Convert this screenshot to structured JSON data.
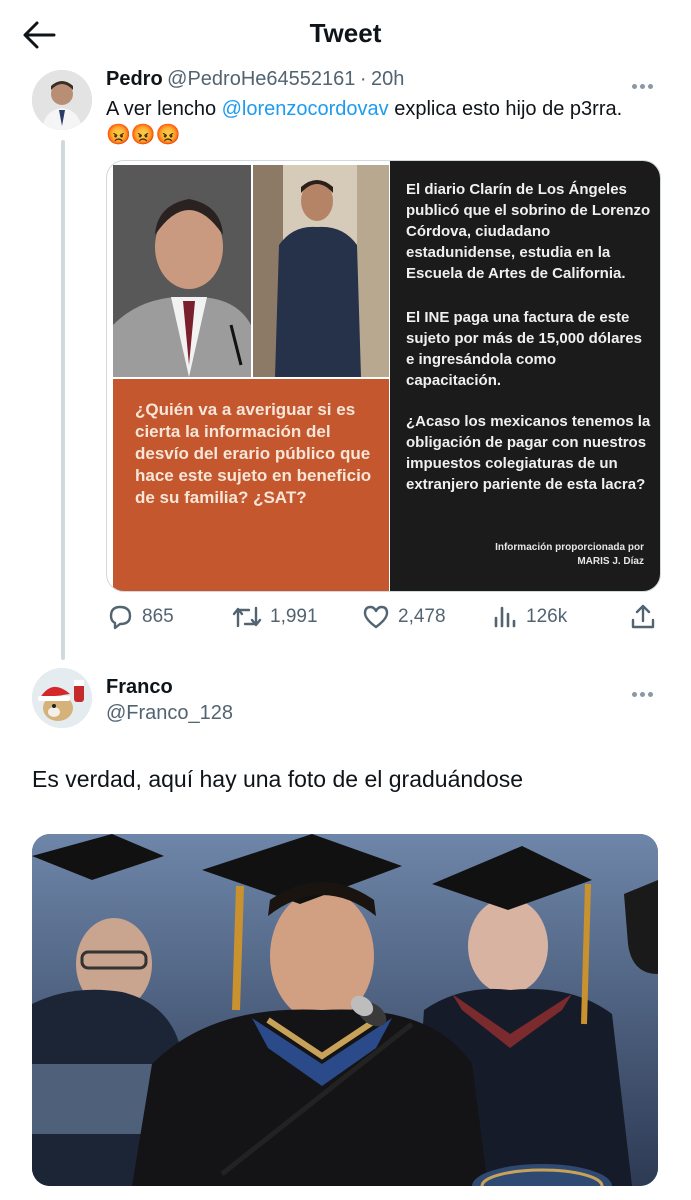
{
  "header": {
    "title": "Tweet"
  },
  "tweet": {
    "author_name": "Pedro",
    "handle": "@PedroHe64552161",
    "dot": "·",
    "time": "20h",
    "text_before": "A ver lencho ",
    "mention": "@lorenzocordovav",
    "text_after": " explica esto hijo de p3rra.",
    "emojis": "😡😡😡",
    "image": {
      "orange_text": "¿Quién va a averiguar si es cierta la información del desvío del erario público que hace este sujeto en beneficio de su familia? ¿SAT?",
      "para1": "El diario Clarín de Los Ángeles publicó que el sobrino de Lorenzo Córdova, ciudadano estadunidense, estudia en la Escuela de Artes de California.",
      "para2": "El INE paga una factura de este sujeto por más de 15,000 dólares e ingresándola como capacitación.",
      "para3": "¿Acaso los mexicanos tenemos la obligación de pagar con nuestros impuestos colegiaturas de un extranjero pariente de esta lacra?",
      "credit1": "Información proporcionada por",
      "credit2": "MARIS J. Díaz"
    },
    "stats": {
      "replies": "865",
      "retweets": "1,991",
      "likes": "2,478",
      "views": "126k"
    }
  },
  "reply": {
    "author_name": "Franco",
    "handle": "@Franco_128",
    "text": "Es verdad, aquí hay una foto de el graduándose"
  },
  "icons": [
    "back-arrow-icon",
    "more-icon",
    "reply-icon",
    "retweet-icon",
    "like-icon",
    "views-icon",
    "share-icon"
  ],
  "colors": {
    "link": "#1d9bf0",
    "muted": "#536471",
    "thread_line": "#cfd9de",
    "orange_panel": "#c4572e"
  }
}
